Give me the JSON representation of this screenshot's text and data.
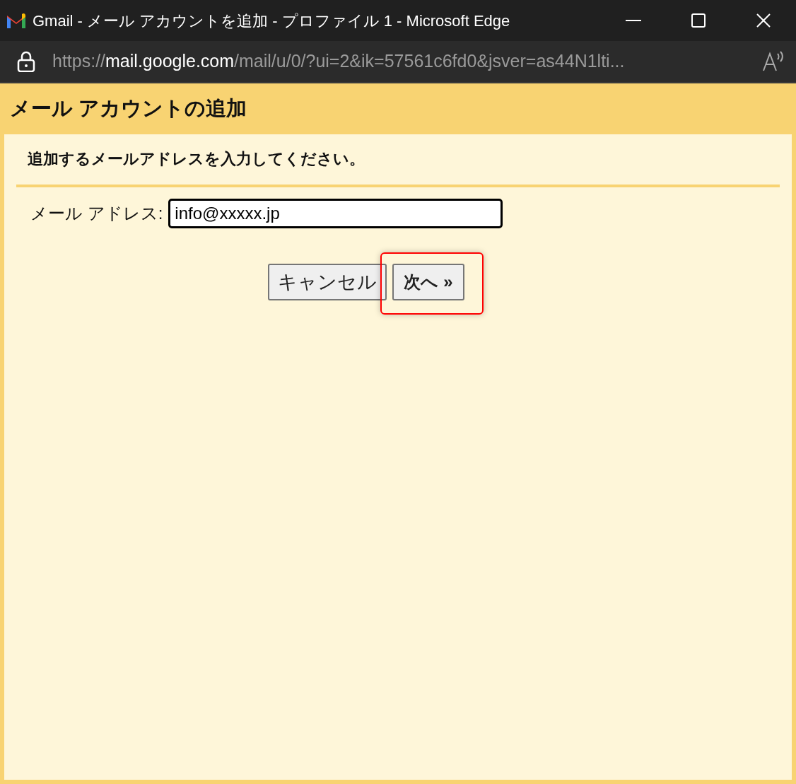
{
  "window": {
    "title": "Gmail - メール アカウントを追加 - プロファイル 1 - Microsoft Edge",
    "url": "https://**mail.google.com**/mail/u/0/?ui=2&ik=57561c6fd0&jsver=as44N1lti..."
  },
  "dialog": {
    "title": "メール アカウントの追加",
    "instruction": "追加するメールアドレスを入力してください。",
    "field": {
      "label": "メール アドレス:",
      "value": "info@xxxxx.jp"
    },
    "buttons": [
      {
        "label": "キャンセル",
        "kind": "plain",
        "highlighted": false
      },
      {
        "label": "次へ »",
        "kind": "default",
        "highlighted": true
      }
    ]
  }
}
